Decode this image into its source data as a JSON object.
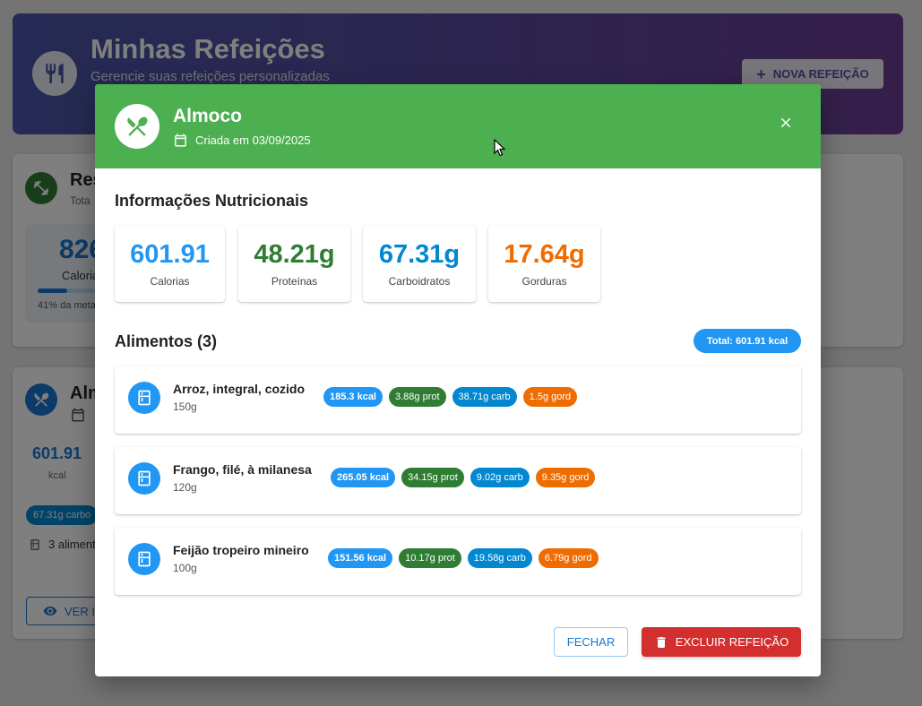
{
  "page": {
    "title": "Minhas Refeições",
    "subtitle": "Gerencie suas refeições personalizadas",
    "new_meal_label": "NOVA REFEIÇÃO"
  },
  "background": {
    "summary_title": "Res",
    "summary_sub": "Tota",
    "calories_num": "826",
    "calories_label": "Calorias",
    "goal_percent": 41,
    "goal_note": "41% da meta",
    "meal_card_title": "Alm",
    "meal_card_calories": "601.91",
    "meal_card_kcal": "kcal",
    "meal_card_chip": "67.31g carbo",
    "meal_card_count": "3 aliment",
    "meal_card_button": "VER I"
  },
  "modal": {
    "title": "Almoco",
    "created": "Criada em 03/09/2025",
    "nutrition_title": "Informações Nutricionais",
    "nutrition": [
      {
        "value": "601.91",
        "label": "Calorias",
        "color": "#2196f3"
      },
      {
        "value": "48.21g",
        "label": "Proteínas",
        "color": "#2e7d32"
      },
      {
        "value": "67.31g",
        "label": "Carboidratos",
        "color": "#0288d1"
      },
      {
        "value": "17.64g",
        "label": "Gorduras",
        "color": "#ef6c00"
      }
    ],
    "foods_title": "Alimentos (3)",
    "total_label": "Total: 601.91 kcal",
    "foods": [
      {
        "name": "Arroz, integral, cozido",
        "qty": "150g",
        "kcal": "185.3 kcal",
        "prot": "3.88g prot",
        "carb": "38.71g carb",
        "gord": "1.5g gord"
      },
      {
        "name": "Frango, filé, à milanesa",
        "qty": "120g",
        "kcal": "265.05 kcal",
        "prot": "34.15g prot",
        "carb": "9.02g carb",
        "gord": "9.35g gord"
      },
      {
        "name": "Feijão tropeiro mineiro",
        "qty": "100g",
        "kcal": "151.56 kcal",
        "prot": "10.17g prot",
        "carb": "19.58g carb",
        "gord": "6.79g gord"
      }
    ],
    "close_label": "FECHAR",
    "delete_label": "EXCLUIR REFEIÇÃO"
  }
}
